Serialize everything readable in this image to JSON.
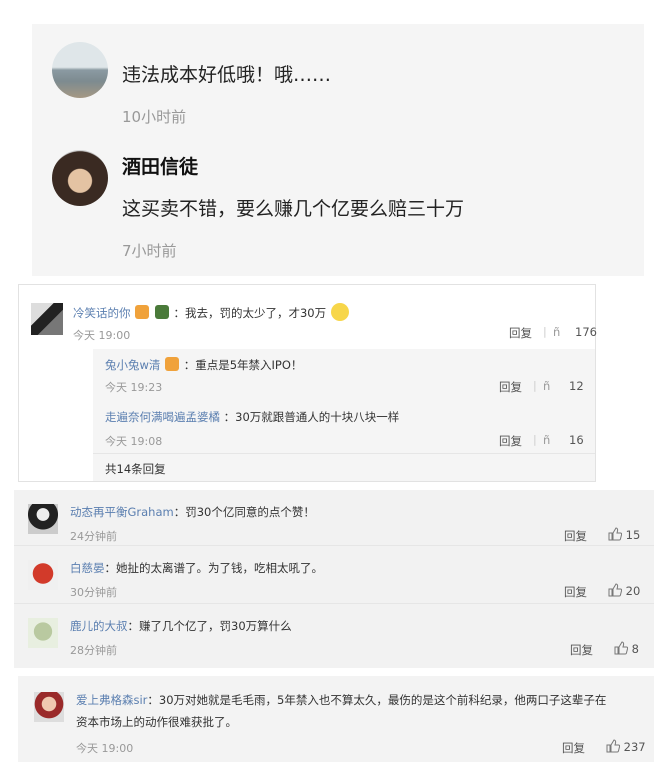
{
  "panel1": {
    "comment1": {
      "text": "违法成本好低哦！哦……",
      "time": "10小时前"
    },
    "comment2": {
      "name": "酒田信徒",
      "text": "这买卖不错，要么赚几个亿要么赔三十万",
      "time": "7小时前"
    }
  },
  "panel2": {
    "main": {
      "name": "冷笑话的你",
      "text": "：我去，罚的太少了，才30万",
      "time": "今天 19:00",
      "reply": "回复",
      "like_sep": "|",
      "like_glyph": "ñ",
      "likes": "176"
    },
    "replies": [
      {
        "name": "兔小兔w清",
        "text": "：重点是5年禁入IPO！",
        "time": "今天 19:23",
        "reply": "回复",
        "like_glyph": "ñ",
        "likes": "12"
      },
      {
        "name": "走遍奈何满喝遍孟婆橘",
        "text": "：30万就跟普通人的十块八块一样",
        "time": "今天 19:08",
        "reply": "回复",
        "like_glyph": "ñ",
        "likes": "16"
      }
    ],
    "more": "共14条回复"
  },
  "panel3": {
    "rows": [
      {
        "name": "动态再平衡Graham",
        "text": "：罚30个亿同意的点个赞！",
        "time": "24分钟前",
        "reply": "回复",
        "likes": "15"
      },
      {
        "name": "白慈晏",
        "text": "：她扯的太离谱了。为了钱，吃相太吼了。",
        "time": "30分钟前",
        "reply": "回复",
        "likes": "20"
      },
      {
        "name": "鹿儿的大叔",
        "text": "：赚了几个亿了，罚30万算什么",
        "time": "28分钟前",
        "reply": "回复",
        "likes": "8"
      }
    ]
  },
  "panel4": {
    "name": "爱上弗格森sir",
    "text_line1": "：30万对她就是毛毛雨，5年禁入也不算太久，最伤的是这个前科纪录，他两口子这辈子在",
    "text_line2": "资本市场上的动作很难获批了。",
    "time": "今天 19:00",
    "reply": "回复",
    "likes": "237"
  }
}
